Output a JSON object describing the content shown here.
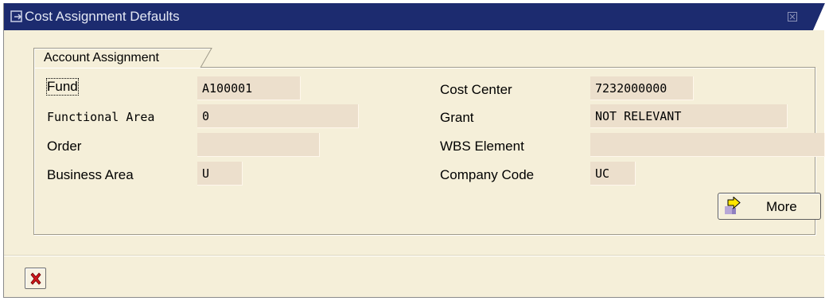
{
  "dialog": {
    "title": "Cost Assignment Defaults",
    "title_icon": "dialog-window-icon",
    "close_icon": "close-icon"
  },
  "tab": {
    "label": "Account Assignment"
  },
  "fields": {
    "fund": {
      "label": "Fund",
      "value": "A100001"
    },
    "functional_area": {
      "label": "Functional Area",
      "value": "0"
    },
    "order": {
      "label": "Order",
      "value": ""
    },
    "business_area": {
      "label": "Business Area",
      "value": "U"
    },
    "cost_center": {
      "label": "Cost Center",
      "value": "7232000000"
    },
    "grant": {
      "label": "Grant",
      "value": "NOT RELEVANT"
    },
    "wbs_element": {
      "label": "WBS Element",
      "value": ""
    },
    "company_code": {
      "label": "Company Code",
      "value": "UC"
    }
  },
  "buttons": {
    "more_label": "More",
    "more_icon": "arrow-right-icon",
    "cancel_icon": "cancel-x-icon"
  },
  "colors": {
    "titlebar": "#1c2b6f",
    "background": "#f5efd9",
    "field_bg": "#ecdfcc",
    "cancel_red": "#d0161b"
  }
}
